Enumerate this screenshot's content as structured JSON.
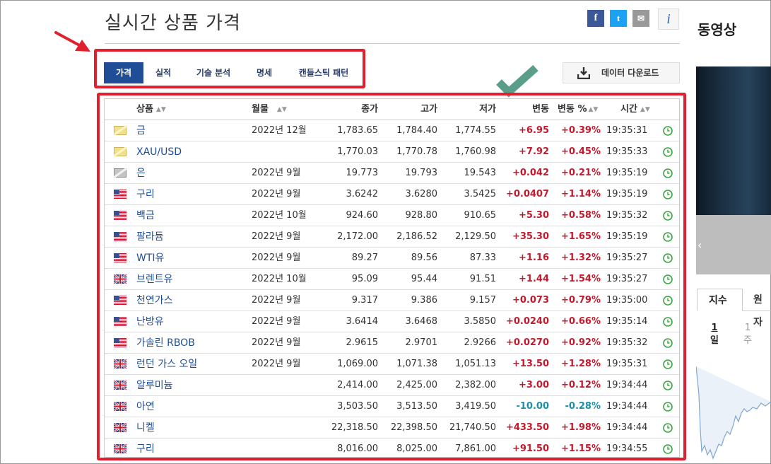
{
  "page": {
    "title": "실시간 상품 가격"
  },
  "share": {
    "facebook": "f",
    "twitter": "t",
    "mail": "✉",
    "info": "i"
  },
  "tabs": [
    {
      "label": "가격",
      "active": true
    },
    {
      "label": "실적",
      "active": false
    },
    {
      "label": "기술 분석",
      "active": false
    },
    {
      "label": "명세",
      "active": false
    },
    {
      "label": "캔들스틱 패턴",
      "active": false
    }
  ],
  "download": {
    "label": "데이터 다운로드",
    "icon": "download-icon"
  },
  "table": {
    "headers": {
      "name": "상품",
      "month": "월물",
      "close": "종가",
      "high": "고가",
      "low": "저가",
      "change": "변동",
      "change_pct": "변동 %",
      "time": "시간"
    },
    "rows": [
      {
        "flag": "gold",
        "name": "금",
        "month": "2022년 12월",
        "close": "1,783.65",
        "high": "1,784.40",
        "low": "1,774.55",
        "change": "+6.95",
        "change_pct": "+0.39%",
        "time": "19:35:31",
        "dir": "pos"
      },
      {
        "flag": "gold",
        "name": "XAU/USD",
        "month": "",
        "close": "1,770.03",
        "high": "1,770.78",
        "low": "1,760.98",
        "change": "+7.92",
        "change_pct": "+0.45%",
        "time": "19:35:33",
        "dir": "pos"
      },
      {
        "flag": "silver",
        "name": "은",
        "month": "2022년 9월",
        "close": "19.773",
        "high": "19.793",
        "low": "19.543",
        "change": "+0.042",
        "change_pct": "+0.21%",
        "time": "19:35:19",
        "dir": "pos"
      },
      {
        "flag": "us",
        "name": "구리",
        "month": "2022년 9월",
        "close": "3.6242",
        "high": "3.6280",
        "low": "3.5425",
        "change": "+0.0407",
        "change_pct": "+1.14%",
        "time": "19:35:19",
        "dir": "pos"
      },
      {
        "flag": "us",
        "name": "백금",
        "month": "2022년 10월",
        "close": "924.60",
        "high": "928.80",
        "low": "910.65",
        "change": "+5.30",
        "change_pct": "+0.58%",
        "time": "19:35:32",
        "dir": "pos"
      },
      {
        "flag": "us",
        "name": "팔라듐",
        "month": "2022년 9월",
        "close": "2,172.00",
        "high": "2,186.52",
        "low": "2,129.50",
        "change": "+35.30",
        "change_pct": "+1.65%",
        "time": "19:35:19",
        "dir": "pos"
      },
      {
        "flag": "us",
        "name": "WTI유",
        "month": "2022년 9월",
        "close": "89.27",
        "high": "89.56",
        "low": "87.33",
        "change": "+1.16",
        "change_pct": "+1.32%",
        "time": "19:35:27",
        "dir": "pos"
      },
      {
        "flag": "uk",
        "name": "브렌트유",
        "month": "2022년 10월",
        "close": "95.09",
        "high": "95.44",
        "low": "91.51",
        "change": "+1.44",
        "change_pct": "+1.54%",
        "time": "19:35:27",
        "dir": "pos"
      },
      {
        "flag": "us",
        "name": "천연가스",
        "month": "2022년 9월",
        "close": "9.317",
        "high": "9.386",
        "low": "9.157",
        "change": "+0.073",
        "change_pct": "+0.79%",
        "time": "19:35:00",
        "dir": "pos"
      },
      {
        "flag": "us",
        "name": "난방유",
        "month": "2022년 9월",
        "close": "3.6414",
        "high": "3.6468",
        "low": "3.5850",
        "change": "+0.0240",
        "change_pct": "+0.66%",
        "time": "19:35:14",
        "dir": "pos"
      },
      {
        "flag": "us",
        "name": "가솔린 RBOB",
        "month": "2022년 9월",
        "close": "2.9615",
        "high": "2.9701",
        "low": "2.9266",
        "change": "+0.0270",
        "change_pct": "+0.92%",
        "time": "19:35:32",
        "dir": "pos"
      },
      {
        "flag": "uk",
        "name": "런던 가스 오일",
        "month": "2022년 9월",
        "close": "1,069.00",
        "high": "1,071.38",
        "low": "1,051.13",
        "change": "+13.50",
        "change_pct": "+1.28%",
        "time": "19:35:31",
        "dir": "pos"
      },
      {
        "flag": "uk",
        "name": "알루미늄",
        "month": "",
        "close": "2,414.00",
        "high": "2,425.00",
        "low": "2,382.00",
        "change": "+3.00",
        "change_pct": "+0.12%",
        "time": "19:34:44",
        "dir": "pos"
      },
      {
        "flag": "uk",
        "name": "아연",
        "month": "",
        "close": "3,503.50",
        "high": "3,513.50",
        "low": "3,419.50",
        "change": "-10.00",
        "change_pct": "-0.28%",
        "time": "19:34:44",
        "dir": "neg"
      },
      {
        "flag": "uk",
        "name": "니켈",
        "month": "",
        "close": "22,318.50",
        "high": "22,398.50",
        "low": "21,740.50",
        "change": "+433.50",
        "change_pct": "+1.98%",
        "time": "19:34:44",
        "dir": "pos"
      },
      {
        "flag": "uk",
        "name": "구리",
        "month": "",
        "close": "8,016.00",
        "high": "8,025.00",
        "low": "7,861.00",
        "change": "+91.50",
        "change_pct": "+1.15%",
        "time": "19:34:55",
        "dir": "pos"
      }
    ]
  },
  "sidebar": {
    "title": "동영상",
    "index_tabs": {
      "active": "지수",
      "inactive": "원자"
    },
    "periods": [
      {
        "num": "1",
        "unit": "일"
      },
      {
        "num": "1",
        "unit": "주"
      }
    ],
    "video_nav": "‹"
  },
  "colors": {
    "positive": "#c4192c",
    "negative": "#1a8fa8",
    "accent": "#1f4e96",
    "annotation": "#e0202e",
    "check": "#5a9e8a"
  }
}
